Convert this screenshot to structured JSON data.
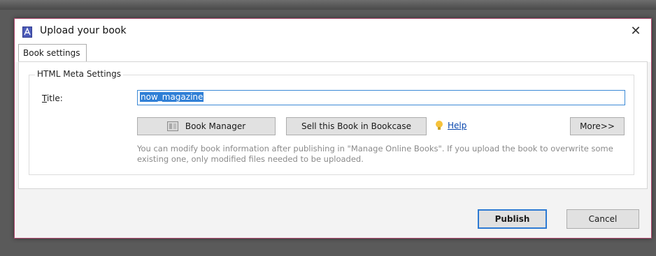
{
  "window": {
    "title": "Upload your book",
    "close_glyph": "✕",
    "app_icon": "pdf-app-icon"
  },
  "tabs": [
    {
      "label": "Book settings",
      "selected": true
    }
  ],
  "group": {
    "legend": "HTML Meta Settings"
  },
  "title_field": {
    "label_accel": "T",
    "label_rest": "itle:",
    "value": "now_magazine",
    "selected": true
  },
  "buttons": {
    "book_manager": "Book Manager",
    "sell": "Sell this Book in Bookcase",
    "help": "Help",
    "more": "More>>",
    "publish": "Publish",
    "cancel": "Cancel"
  },
  "note": "You can modify book information after publishing in \"Manage Online Books\". If you upload the book to overwrite some existing one, only modified files needed to be uploaded.",
  "colors": {
    "window_border": "#b0476e",
    "focus_blue": "#2d7ad3",
    "selection": "#2f7fd6",
    "link": "#0645ad"
  }
}
